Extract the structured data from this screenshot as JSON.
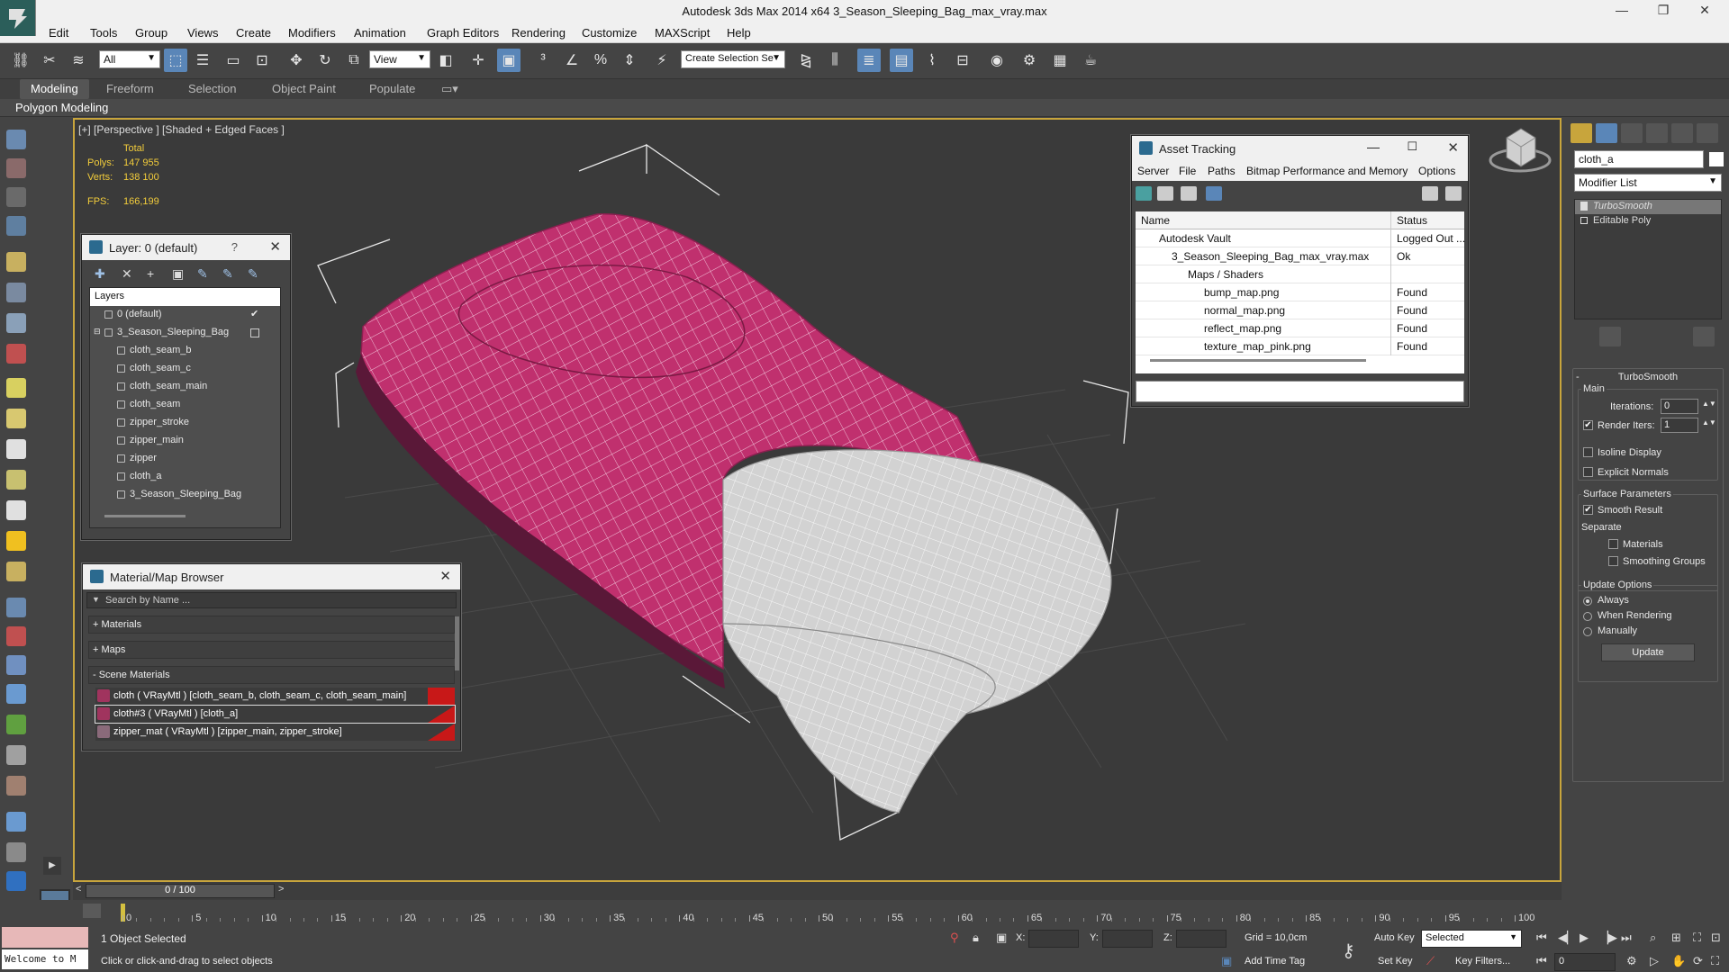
{
  "titlebar": {
    "title": "Autodesk 3ds Max  2014 x64     3_Season_Sleeping_Bag_max_vray.max"
  },
  "menu": [
    "Edit",
    "Tools",
    "Group",
    "Views",
    "Create",
    "Modifiers",
    "Animation",
    "Graph Editors",
    "Rendering",
    "Customize",
    "MAXScript",
    "Help"
  ],
  "toolbar": {
    "filter": "All",
    "ref_coord": "View",
    "selection_set": "Create Selection Se"
  },
  "ribbon": {
    "tabs": [
      "Modeling",
      "Freeform",
      "Selection",
      "Object Paint",
      "Populate"
    ],
    "active_tab": "Modeling",
    "panel": "Polygon Modeling"
  },
  "viewport": {
    "label": "[+] [Perspective ] [Shaded + Edged Faces ]",
    "stats": {
      "total_label": "Total",
      "polys_label": "Polys:",
      "polys": "147 955",
      "verts_label": "Verts:",
      "verts": "138 100",
      "fps_label": "FPS:",
      "fps": "166,199"
    }
  },
  "layer_window": {
    "title": "Layer: 0 (default)",
    "help": "?",
    "header": "Layers",
    "rows": [
      "0 (default)",
      "3_Season_Sleeping_Bag",
      "cloth_seam_b",
      "cloth_seam_c",
      "cloth_seam_main",
      "cloth_seam",
      "zipper_stroke",
      "zipper_main",
      "zipper",
      "cloth_a",
      "3_Season_Sleeping_Bag"
    ]
  },
  "material_browser": {
    "title": "Material/Map Browser",
    "search_placeholder": "Search by Name ...",
    "groups": [
      "+ Materials",
      "+ Maps",
      "- Scene Materials"
    ],
    "materials": [
      "cloth  ( VRayMtl ) [cloth_seam_b, cloth_seam_c, cloth_seam_main]",
      "cloth#3  ( VRayMtl ) [cloth_a]",
      "zipper_mat  ( VRayMtl ) [zipper_main, zipper_stroke]"
    ]
  },
  "asset_tracking": {
    "title": "Asset Tracking",
    "menu": [
      "Server",
      "File",
      "Paths",
      "Bitmap Performance and Memory",
      "Options"
    ],
    "col_name": "Name",
    "col_status": "Status",
    "rows": [
      {
        "name": "Autodesk Vault",
        "status": "Logged Out ..."
      },
      {
        "name": "3_Season_Sleeping_Bag_max_vray.max",
        "status": "Ok"
      },
      {
        "name": "Maps / Shaders",
        "status": ""
      },
      {
        "name": "bump_map.png",
        "status": "Found"
      },
      {
        "name": "normal_map.png",
        "status": "Found"
      },
      {
        "name": "reflect_map.png",
        "status": "Found"
      },
      {
        "name": "texture_map_pink.png",
        "status": "Found"
      }
    ]
  },
  "command_panel": {
    "object_name": "cloth_a",
    "modifier_list": "Modifier List",
    "stack": [
      "TurboSmooth",
      "Editable Poly"
    ],
    "rollout_title": "TurboSmooth",
    "main_label": "Main",
    "iterations_label": "Iterations:",
    "iterations": "0",
    "render_iters_label": "Render Iters:",
    "render_iters": "1",
    "isoline": "Isoline Display",
    "explicit_normals": "Explicit Normals",
    "surface_params": "Surface Parameters",
    "smooth_result": "Smooth Result",
    "separate": "Separate",
    "materials": "Materials",
    "smoothing_groups": "Smoothing Groups",
    "update_options": "Update Options",
    "always": "Always",
    "when_rendering": "When Rendering",
    "manually": "Manually",
    "update_button": "Update"
  },
  "timeline": {
    "frame": "0 / 100",
    "ticks": [
      "0",
      "5",
      "10",
      "15",
      "20",
      "25",
      "30",
      "35",
      "40",
      "45",
      "50",
      "55",
      "60",
      "65",
      "70",
      "75",
      "80",
      "85",
      "90",
      "95",
      "100"
    ]
  },
  "status": {
    "welcome": "Welcome to M",
    "objects_selected": "1 Object Selected",
    "prompt": "Click or click-and-drag to select objects",
    "x_label": "X:",
    "y_label": "Y:",
    "z_label": "Z:",
    "grid": "Grid = 10,0cm",
    "add_time_tag": "Add Time Tag",
    "auto_key": "Auto Key",
    "set_key": "Set Key",
    "selected": "Selected",
    "key_filters": "Key Filters...",
    "frame_field": "0"
  },
  "colors": {
    "bag_pink": "#c0306e",
    "lining_gray": "#d8d8d8",
    "viewport_border": "#c8a53c",
    "stat_yellow": "#f2cc3b"
  }
}
